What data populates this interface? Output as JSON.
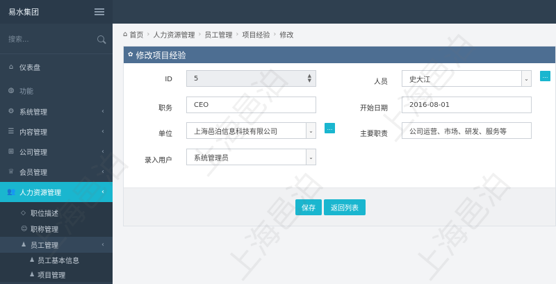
{
  "app": {
    "brand": "易水集团"
  },
  "sidebar": {
    "search_placeholder": "搜索...",
    "dashboard": "仪表盘",
    "section": "功能",
    "items": [
      {
        "label": "系统管理"
      },
      {
        "label": "内容管理"
      },
      {
        "label": "公司管理"
      },
      {
        "label": "会员管理"
      },
      {
        "label": "人力资源管理"
      }
    ],
    "sub_items": [
      {
        "label": "职位描述"
      },
      {
        "label": "职称管理"
      },
      {
        "label": "员工管理"
      }
    ],
    "subsub_items": [
      {
        "label": "员工基本信息"
      },
      {
        "label": "项目管理"
      }
    ]
  },
  "breadcrumb": [
    "首页",
    "人力资源管理",
    "员工管理",
    "项目经验",
    "修改"
  ],
  "panel": {
    "title": "修改项目经验",
    "fields": {
      "id": {
        "label": "ID",
        "value": "5"
      },
      "person": {
        "label": "人员",
        "value": "史大江"
      },
      "position": {
        "label": "职务",
        "value": "CEO"
      },
      "start_date": {
        "label": "开始日期",
        "value": "2016-08-01"
      },
      "unit": {
        "label": "单位",
        "value": "上海邑泊信息科技有限公司"
      },
      "duty": {
        "label": "主要职责",
        "value": "公司运营、市场、研发、服务等"
      },
      "entered_by": {
        "label": "录入用户",
        "value": "系统管理员"
      }
    },
    "buttons": {
      "save": "保存",
      "back": "返回列表"
    }
  },
  "watermark": "上海邑泊",
  "colors": {
    "sidebar": "#2f4050",
    "accent": "#1ab6cf",
    "panel_header": "#4d6e92"
  }
}
